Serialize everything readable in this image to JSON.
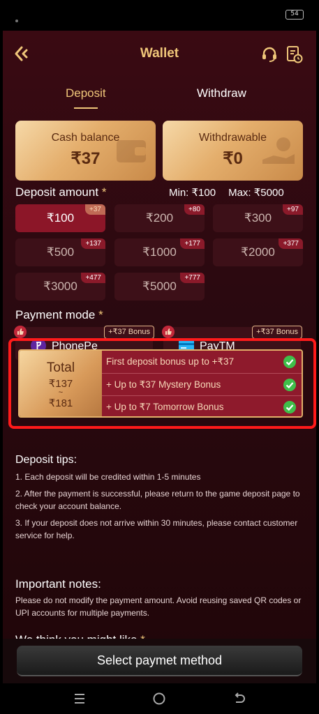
{
  "status": {
    "battery": "54"
  },
  "header": {
    "title": "Wallet"
  },
  "tabs": [
    {
      "label": "Deposit",
      "active": true
    },
    {
      "label": "Withdraw",
      "active": false
    }
  ],
  "balances": {
    "cash": {
      "label": "Cash balance",
      "value": "₹37"
    },
    "withdrawable": {
      "label": "Withdrawable",
      "value": "₹0"
    }
  },
  "deposit": {
    "label": "Deposit amount",
    "required_mark": "*",
    "min": "Min: ₹100",
    "max": "Max: ₹5000",
    "amounts": [
      {
        "value": "₹100",
        "bonus": "+37",
        "selected": true
      },
      {
        "value": "₹200",
        "bonus": "+80",
        "selected": false
      },
      {
        "value": "₹300",
        "bonus": "+97",
        "selected": false
      },
      {
        "value": "₹500",
        "bonus": "+137",
        "selected": false
      },
      {
        "value": "₹1000",
        "bonus": "+177",
        "selected": false
      },
      {
        "value": "₹2000",
        "bonus": "+377",
        "selected": false
      },
      {
        "value": "₹3000",
        "bonus": "+477",
        "selected": false
      },
      {
        "value": "₹5000",
        "bonus": "+777",
        "selected": false
      }
    ]
  },
  "payment": {
    "label": "Payment mode",
    "required_mark": "*",
    "methods": [
      {
        "name": "PhonePe",
        "bonus": "+₹37 Bonus",
        "logo": "phonepe-logo"
      },
      {
        "name": "PayTM",
        "bonus": "+₹37 Bonus",
        "logo": "paytm-card-logo"
      }
    ]
  },
  "bonus_banner": {
    "total_label": "Total",
    "from": "₹137",
    "tilde": "~",
    "to": "₹181",
    "rows": [
      "First deposit bonus up to +₹37",
      "+ Up to ₹37 Mystery Bonus",
      "+ Up to ₹7 Tomorrow Bonus"
    ]
  },
  "tips": {
    "title": "Deposit tips:",
    "items": [
      "1. Each deposit will be credited within 1-5 minutes",
      "2. After the payment is successful, please return to the game deposit page to check your account balance.",
      "3. If your deposit does not arrive within 30 minutes, please contact customer service for help."
    ]
  },
  "notes": {
    "title": "Important notes:",
    "body": "Please do not modify the payment amount. Avoid reusing saved QR codes or UPI accounts for multiple payments."
  },
  "suggest": {
    "title": "We think you might like",
    "required_mark": "*"
  },
  "footer": {
    "button": "Select paymet method"
  },
  "colors": {
    "accent_gold": "#f0c77a",
    "highlight_red": "#ff1a1a",
    "selected_amount": "#8c1628"
  }
}
